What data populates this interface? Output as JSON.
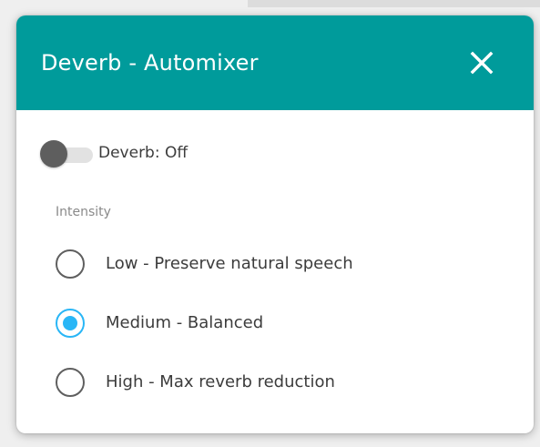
{
  "dialog": {
    "title": "Deverb - Automixer",
    "header_color": "#009b9b",
    "close_icon": "close-icon"
  },
  "deverb_toggle": {
    "label": "Deverb: Off",
    "on": false
  },
  "intensity": {
    "label": "Intensity",
    "selected": "Medium - Balanced",
    "accent_color": "#29b6f6",
    "options": [
      {
        "label": "Low - Preserve natural speech",
        "checked": false
      },
      {
        "label": "Medium - Balanced",
        "checked": true
      },
      {
        "label": "High - Max reverb reduction",
        "checked": false
      }
    ]
  }
}
